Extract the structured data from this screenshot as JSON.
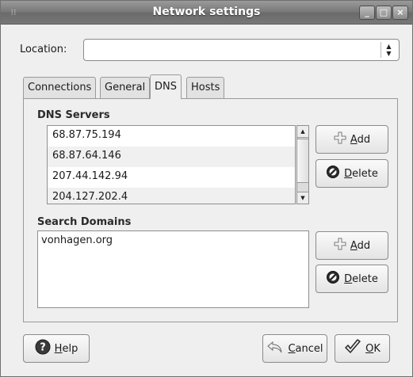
{
  "window": {
    "title": "Network settings"
  },
  "location": {
    "label": "Location:",
    "value": ""
  },
  "tabs": [
    {
      "label": "Connections",
      "active": false
    },
    {
      "label": "General",
      "active": false
    },
    {
      "label": "DNS",
      "active": true
    },
    {
      "label": "Hosts",
      "active": false
    }
  ],
  "dns": {
    "title": "DNS Servers",
    "servers": [
      "68.87.75.194",
      "68.87.64.146",
      "207.44.142.94",
      "204.127.202.4"
    ],
    "add_first": "",
    "add_mnemonic": "A",
    "add_rest": "dd",
    "delete_first": "",
    "delete_mnemonic": "D",
    "delete_rest": "elete"
  },
  "search": {
    "title": "Search Domains",
    "domains": [
      "vonhagen.org"
    ],
    "add_first": "",
    "add_mnemonic": "A",
    "add_rest": "dd",
    "delete_first": "",
    "delete_mnemonic": "D",
    "delete_rest": "elete"
  },
  "footer": {
    "help_mnemonic": "H",
    "help_rest": "elp",
    "cancel_mnemonic": "C",
    "cancel_rest": "ancel",
    "ok_mnemonic": "O",
    "ok_rest": "K"
  },
  "icons": {
    "add": "plus-icon",
    "delete": "delete-icon",
    "help": "help-icon",
    "cancel": "cancel-icon",
    "ok": "ok-icon"
  }
}
